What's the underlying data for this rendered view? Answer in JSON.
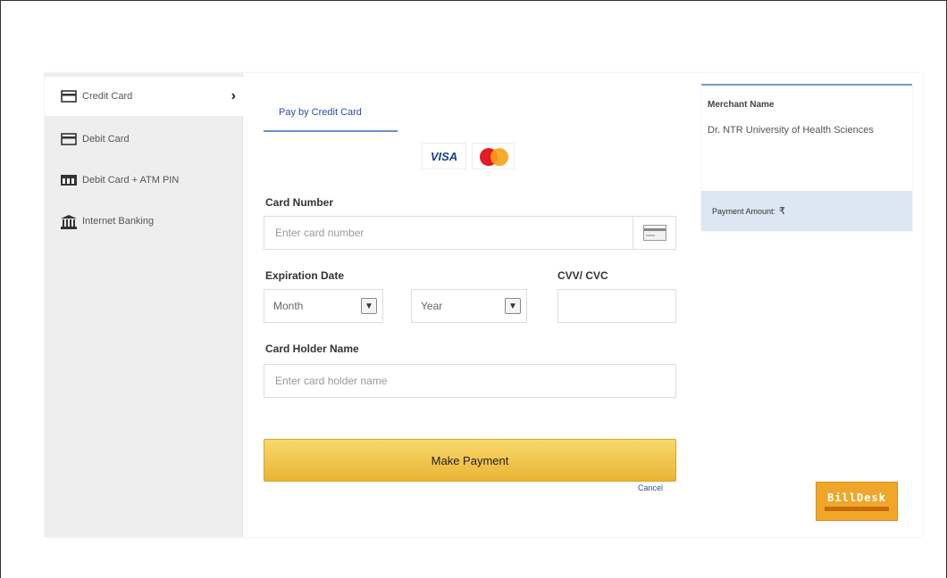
{
  "sidebar": {
    "items": [
      {
        "label": "Credit Card",
        "icon": "credit-card-icon",
        "active": true
      },
      {
        "label": "Debit Card",
        "icon": "debit-card-icon"
      },
      {
        "label": "Debit Card + ATM PIN",
        "icon": "atm-card-icon"
      },
      {
        "label": "Internet Banking",
        "icon": "bank-icon"
      }
    ]
  },
  "tab": {
    "label": "Pay by Credit Card"
  },
  "card_logos": {
    "visa": "VISA"
  },
  "form": {
    "card_number_label": "Card Number",
    "card_number_placeholder": "Enter card number",
    "expiration_label": "Expiration Date",
    "month_value": "Month",
    "year_value": "Year",
    "cvv_label": "CVV/ CVC",
    "holder_label": "Card Holder Name",
    "holder_placeholder": "Enter card holder name",
    "pay_button": "Make Payment",
    "cancel": "Cancel"
  },
  "merchant": {
    "title": "Merchant Name",
    "name": "Dr. NTR University of Health Sciences",
    "amount_label": "Payment Amount:",
    "currency": "₹"
  },
  "branding": {
    "logo_text": "BillDesk"
  },
  "colors": {
    "accent": "#2a4ea0",
    "button": "#eab437",
    "amount_bg": "#dce7f3",
    "billdesk": "#f0a62a"
  }
}
